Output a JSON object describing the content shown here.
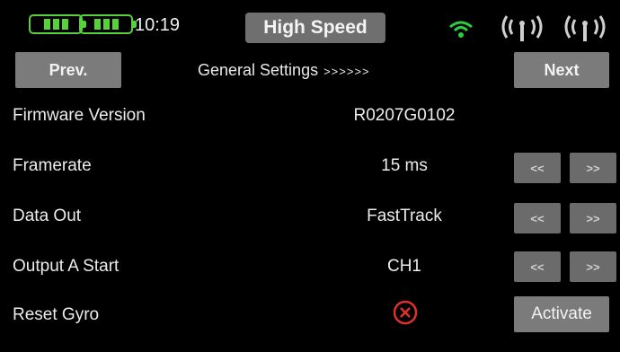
{
  "status_bar": {
    "time": "10:19",
    "mode": "High Speed",
    "icons": [
      "battery-icon",
      "battery-icon",
      "wifi-signal-icon",
      "antenna-signal-icon",
      "antenna-signal-icon"
    ],
    "colors": {
      "battery": "#57d23a",
      "wifi": "#2ecc40",
      "badge": "#6f6f6f"
    }
  },
  "nav": {
    "prev_label": "Prev.",
    "title": "General Settings",
    "title_arrows": ">>>>>>",
    "next_label": "Next"
  },
  "rows": [
    {
      "label": "Firmware Version",
      "value": "R0207G0102"
    },
    {
      "label": "Framerate",
      "value": "15 ms",
      "dec_label": "<<",
      "inc_label": ">>"
    },
    {
      "label": "Data Out",
      "value": "FastTrack",
      "dec_label": "<<",
      "inc_label": ">>"
    },
    {
      "label": "Output A Start",
      "value": "CH1",
      "dec_label": "<<",
      "inc_label": ">>"
    },
    {
      "label": "Reset Gyro",
      "status_icon": "error-x-icon",
      "action_label": "Activate"
    }
  ]
}
